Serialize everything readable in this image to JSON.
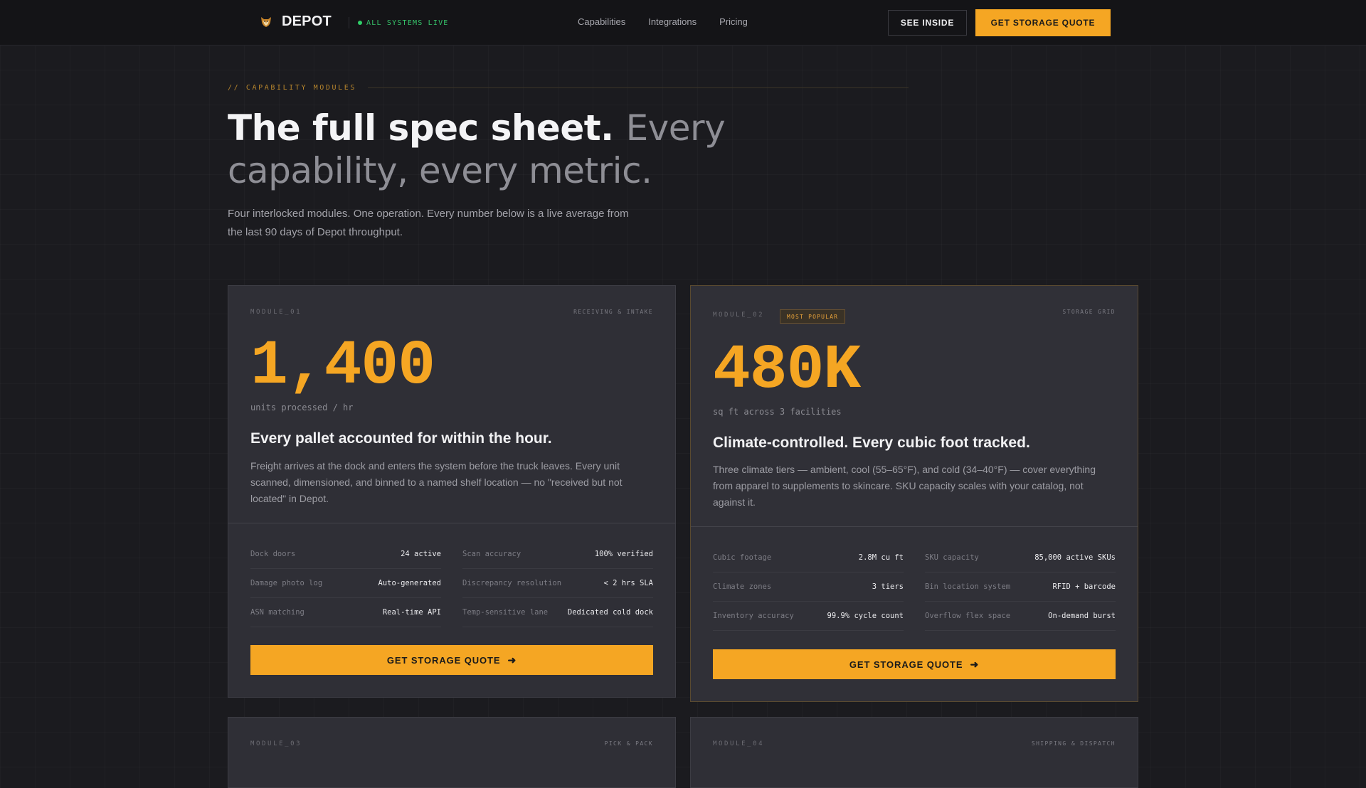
{
  "nav": {
    "brand": "DEPOT",
    "brand_icon": "fox-shield-icon",
    "status": "ALL SYSTEMS LIVE",
    "links": [
      "Capabilities",
      "Integrations",
      "Pricing"
    ],
    "see_inside": "SEE INSIDE",
    "quote": "GET STORAGE QUOTE"
  },
  "hero": {
    "eyebrow": "// CAPABILITY MODULES",
    "headline_strong": "The full spec sheet.",
    "headline_soft": "Every capability, every metric.",
    "lede": "Four interlocked modules. One operation. Every number below is a live average from the last 90 days of Depot throughput."
  },
  "modules": [
    {
      "id": "MODULE_01",
      "tag": "RECEIVING & INTAKE",
      "stat": "1,400",
      "unit": "units processed / hr",
      "title": "Every pallet accounted for within the hour.",
      "desc": "Freight arrives at the dock and enters the system before the truck leaves. Every unit scanned, dimensioned, and binned to a named shelf location — no \"received but not located\" in Depot.",
      "specs": [
        {
          "k": "Dock doors",
          "v": "24 active"
        },
        {
          "k": "Scan accuracy",
          "v": "100% verified"
        },
        {
          "k": "Damage photo log",
          "v": "Auto-generated"
        },
        {
          "k": "Discrepancy resolution",
          "v": "< 2 hrs SLA"
        },
        {
          "k": "ASN matching",
          "v": "Real-time API"
        },
        {
          "k": "Temp-sensitive lane",
          "v": "Dedicated cold dock"
        }
      ],
      "cta": "GET STORAGE QUOTE"
    },
    {
      "id": "MODULE_02",
      "badge": "MOST POPULAR",
      "tag": "STORAGE GRID",
      "stat": "480K",
      "unit": "sq ft across 3 facilities",
      "title": "Climate-controlled. Every cubic foot tracked.",
      "desc": "Three climate tiers — ambient, cool (55–65°F), and cold (34–40°F) — cover everything from apparel to supplements to skincare. SKU capacity scales with your catalog, not against it.",
      "specs": [
        {
          "k": "Cubic footage",
          "v": "2.8M cu ft"
        },
        {
          "k": "SKU capacity",
          "v": "85,000 active SKUs"
        },
        {
          "k": "Climate zones",
          "v": "3 tiers"
        },
        {
          "k": "Bin location system",
          "v": "RFID + barcode"
        },
        {
          "k": "Inventory accuracy",
          "v": "99.9% cycle count"
        },
        {
          "k": "Overflow flex space",
          "v": "On-demand burst"
        }
      ],
      "cta": "GET STORAGE QUOTE"
    },
    {
      "id": "MODULE_03",
      "tag": "PICK & PACK"
    },
    {
      "id": "MODULE_04",
      "tag": "SHIPPING & DISPATCH"
    }
  ]
}
